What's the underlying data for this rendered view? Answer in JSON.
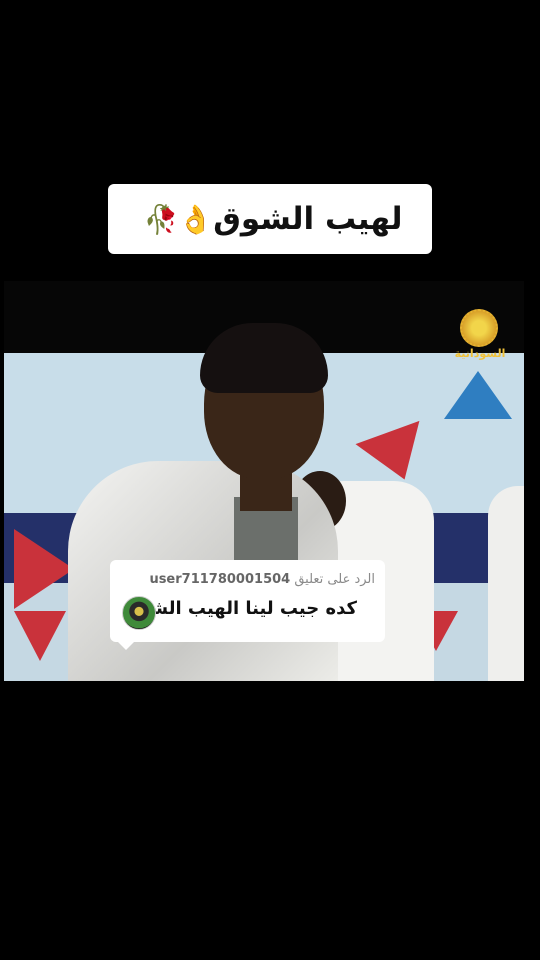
{
  "overlay_title": {
    "text": "لهيب  الشوق",
    "emoji": "🥀👌"
  },
  "video": {
    "channel_logo_text": "السودانية"
  },
  "comment": {
    "reply_prefix": "الرد على تعليق",
    "username": "user711780001504",
    "text": "كده جيب لينا الهيب الشوق"
  }
}
